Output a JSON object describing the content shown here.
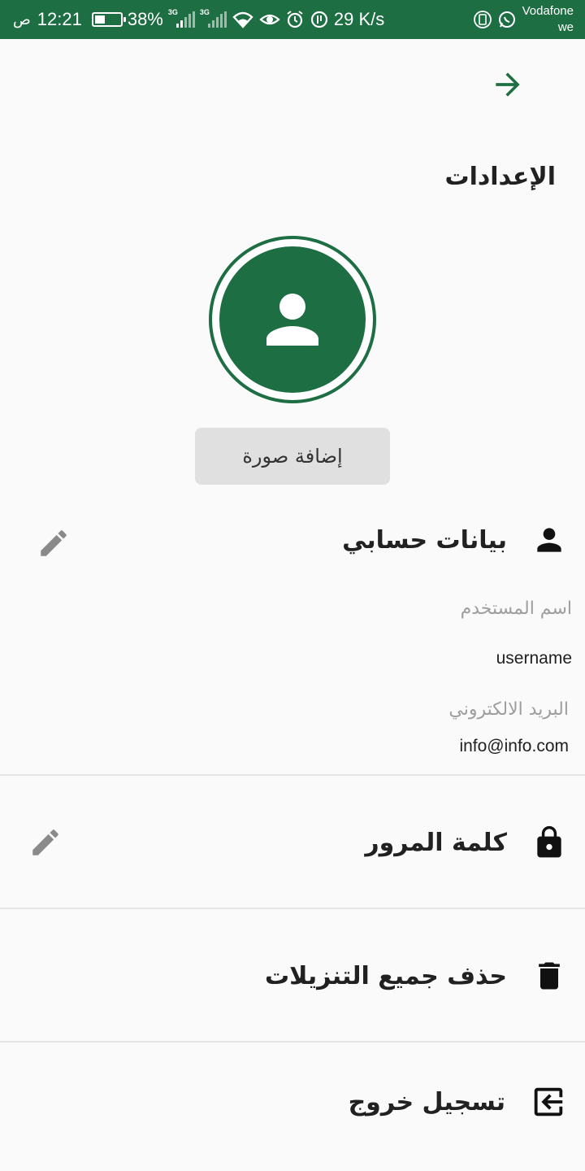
{
  "status_bar": {
    "time": "12:21",
    "ampm": "ص",
    "battery": "38%",
    "net1": "3G",
    "net2": "3G",
    "speed": "29 K/s",
    "carrier_line1": "Vodafone",
    "carrier_line2": "we",
    "colors": {
      "background": "#1e6e43"
    }
  },
  "header": {
    "back_icon": "arrow-right-icon",
    "title": "الإعدادات"
  },
  "profile": {
    "avatar_icon": "person-icon",
    "add_photo_label": "إضافة صورة"
  },
  "account": {
    "title": "بيانات حسابي",
    "icon": "person-icon",
    "edit_icon": "pencil-icon",
    "username_label": "اسم المستخدم",
    "username_value": "username",
    "email_label": "البريد الالكتروني",
    "email_value": "info@info.com"
  },
  "password": {
    "title": "كلمة المرور",
    "icon": "lock-icon",
    "edit_icon": "pencil-icon"
  },
  "delete_downloads": {
    "title": "حذف جميع التنزيلات",
    "icon": "trash-icon"
  },
  "logout": {
    "title": "تسجيل خروج",
    "icon": "exit-icon"
  },
  "theme": {
    "accent": "#1e6e43",
    "icon_gray": "#8a8a8a"
  }
}
